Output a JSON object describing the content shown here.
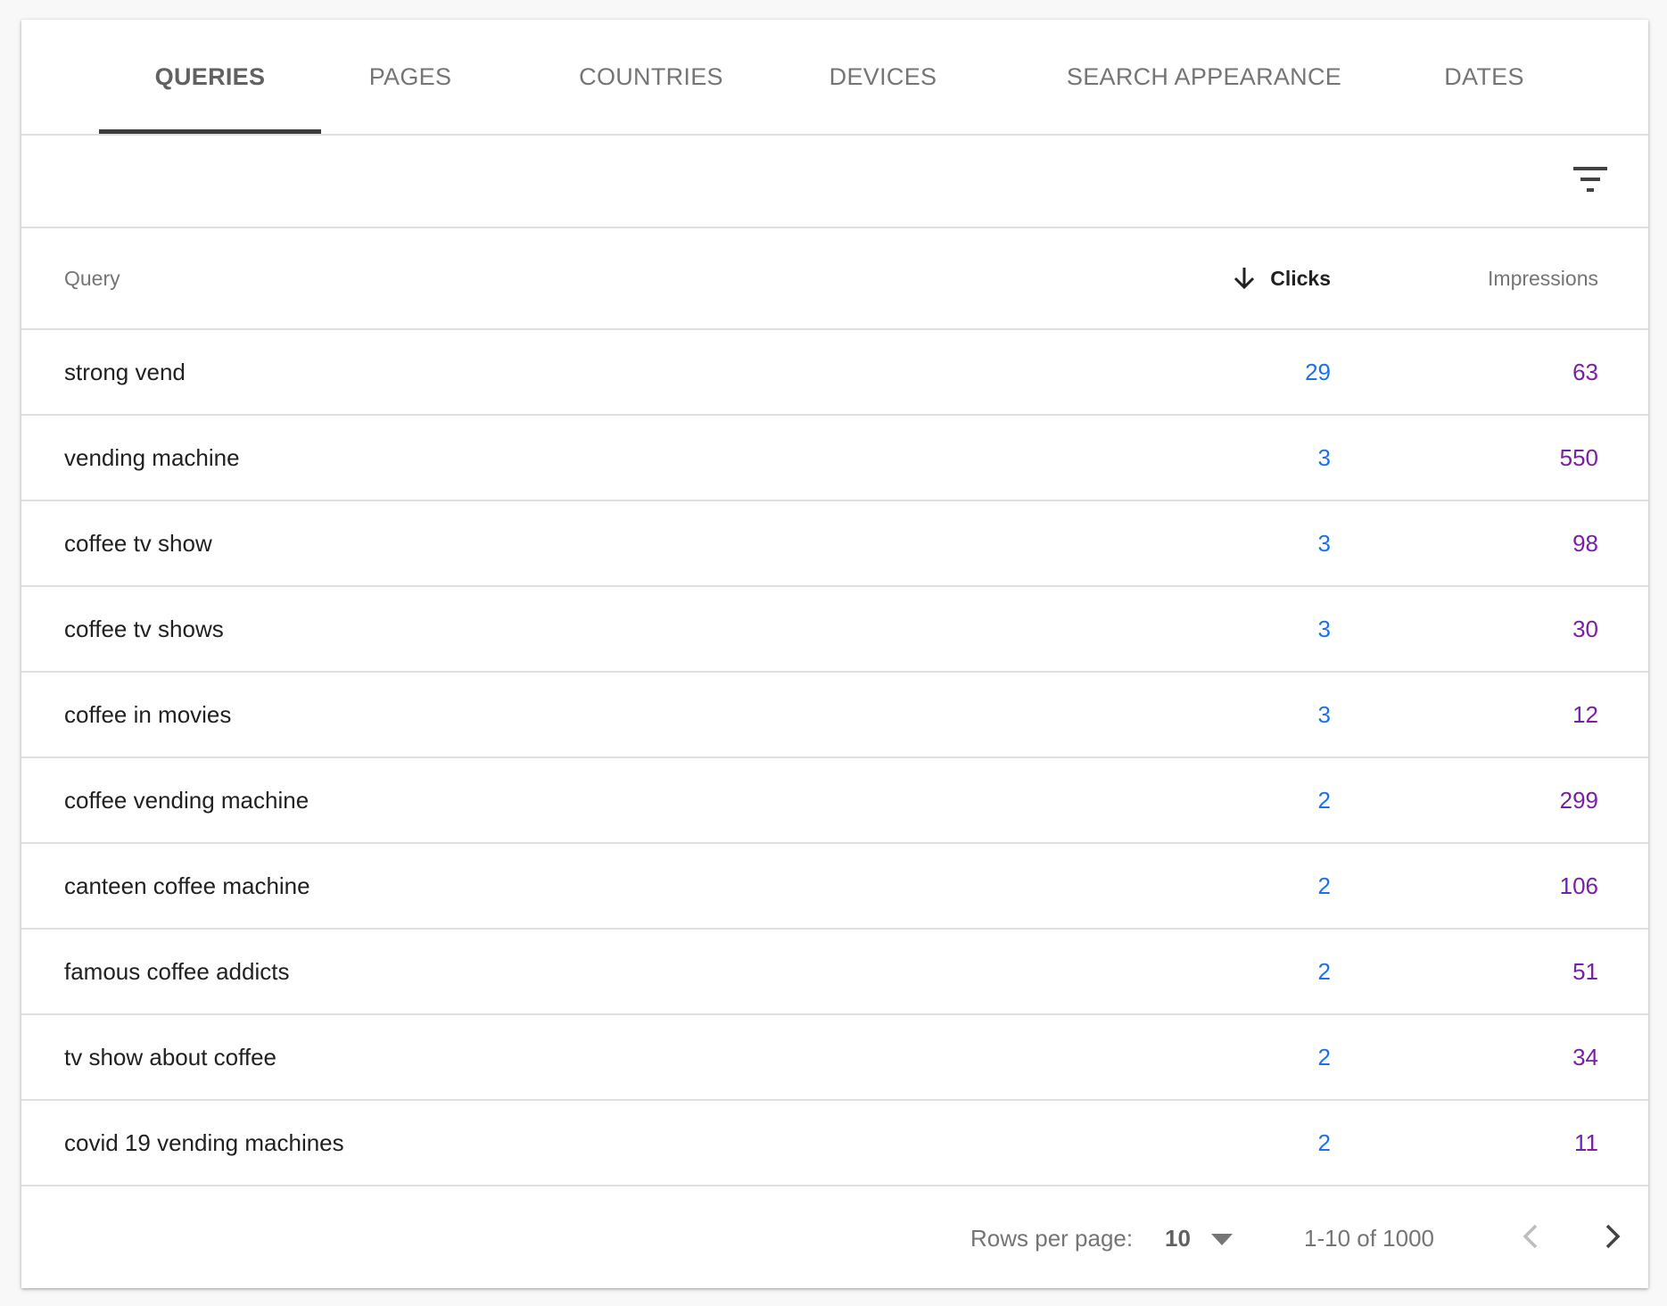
{
  "tabs": [
    {
      "label": "QUERIES",
      "active": true
    },
    {
      "label": "PAGES",
      "active": false
    },
    {
      "label": "COUNTRIES",
      "active": false
    },
    {
      "label": "DEVICES",
      "active": false
    },
    {
      "label": "SEARCH APPEARANCE",
      "active": false
    },
    {
      "label": "DATES",
      "active": false
    }
  ],
  "toolbar": {
    "filter_icon": "filter-list-icon"
  },
  "table": {
    "columns": {
      "query": "Query",
      "clicks": "Clicks",
      "impressions": "Impressions"
    },
    "sort": {
      "column": "clicks",
      "direction": "descending",
      "icon": "arrow-downward-icon"
    },
    "rows": [
      {
        "query": "strong vend",
        "clicks": "29",
        "impressions": "63"
      },
      {
        "query": "vending machine",
        "clicks": "3",
        "impressions": "550"
      },
      {
        "query": "coffee tv show",
        "clicks": "3",
        "impressions": "98"
      },
      {
        "query": "coffee tv shows",
        "clicks": "3",
        "impressions": "30"
      },
      {
        "query": "coffee in movies",
        "clicks": "3",
        "impressions": "12"
      },
      {
        "query": "coffee vending machine",
        "clicks": "2",
        "impressions": "299"
      },
      {
        "query": "canteen coffee machine",
        "clicks": "2",
        "impressions": "106"
      },
      {
        "query": "famous coffee addicts",
        "clicks": "2",
        "impressions": "51"
      },
      {
        "query": "tv show about coffee",
        "clicks": "2",
        "impressions": "34"
      },
      {
        "query": "covid 19 vending machines",
        "clicks": "2",
        "impressions": "11"
      }
    ]
  },
  "footer": {
    "rows_per_page_label": "Rows per page:",
    "rows_per_page_value": "10",
    "range": "1-10 of 1000"
  },
  "colors": {
    "clicks": "#1a73e8",
    "impressions": "#7b1fa2",
    "active_tab_indicator": "#3c3c3c"
  }
}
